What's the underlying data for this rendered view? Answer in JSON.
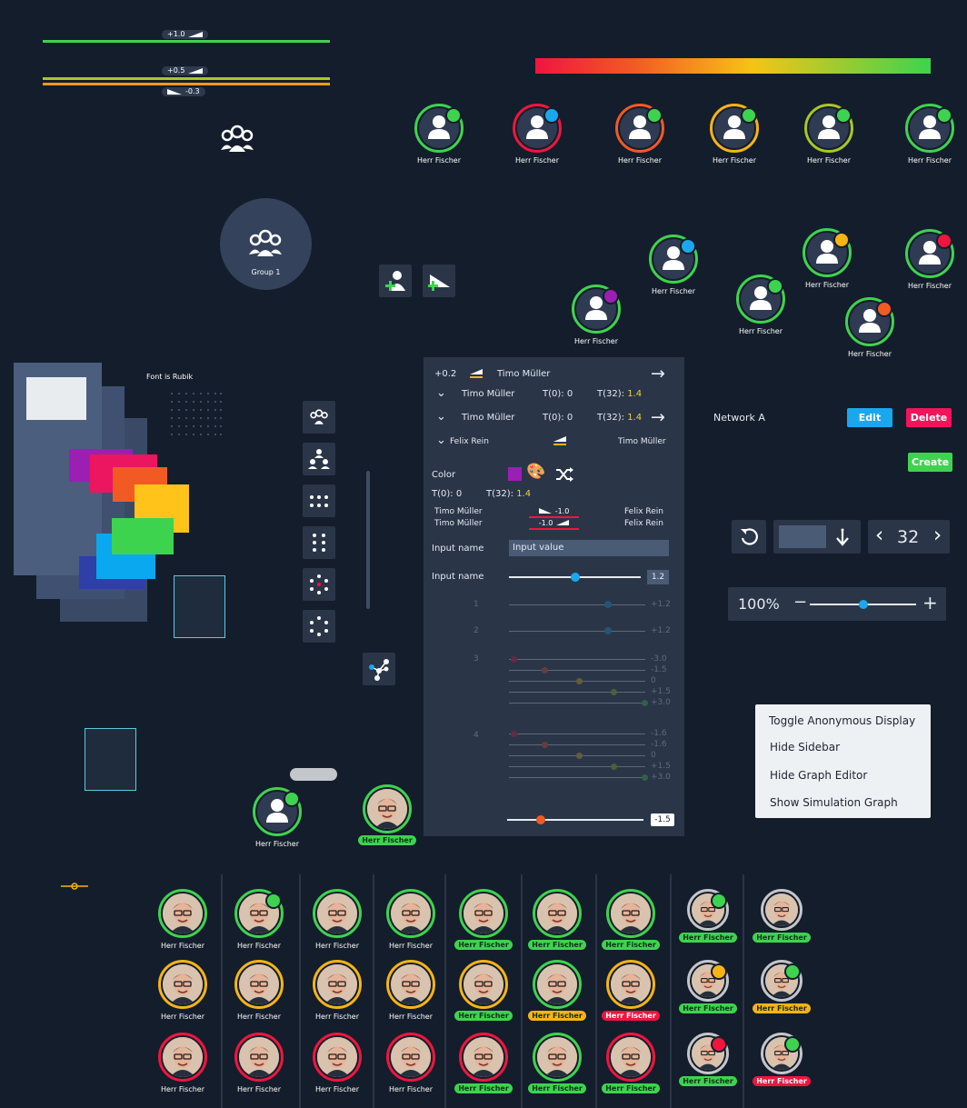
{
  "weights": {
    "top": "+1.0",
    "mid": "+0.5",
    "neg": "-0.3"
  },
  "header": {
    "font_note": "Font is Rubik"
  },
  "group": {
    "label": "Group 1"
  },
  "person": {
    "name": "Herr Fischer"
  },
  "top_avatars": [
    {
      "ring": "#3ed34f",
      "dot": "#3ed34f"
    },
    {
      "ring": "#f0153f",
      "dot": "#1aa7ee"
    },
    {
      "ring": "#f25a24",
      "dot": "#3ed34f"
    },
    {
      "ring": "#f6b415",
      "dot": "#3ed34f"
    },
    {
      "ring": "#a7c824",
      "dot": "#3ed34f"
    },
    {
      "ring": "#3ed34f",
      "dot": "#3ed34f"
    }
  ],
  "colors": {
    "green": "#3ed34f",
    "yellow": "#f6b415",
    "red": "#f0153f",
    "blue": "#1aa7ee",
    "accent_bg": "#2a3548"
  },
  "panel": {
    "r1": {
      "weight": "+0.2",
      "name": "Timo Müller"
    },
    "r2": {
      "name": "Timo Müller",
      "t0": "T(0):  0",
      "t32": "T(32): ",
      "t32v": "1.4"
    },
    "r3": {
      "name": "Timo Müller",
      "t0": "T(0):  0",
      "t32": "T(32): ",
      "t32v": "1.4"
    },
    "r4": {
      "name": "Felix Rein",
      "right": "Timo Müller"
    },
    "color_label": "Color",
    "t_row": {
      "t0": "T(0):  0",
      "t32": "T(32): ",
      "t32v": "1.4"
    },
    "links": [
      {
        "left": "Timo Müller",
        "val": "-1.0",
        "right": "Felix Rein"
      },
      {
        "left": "Timo Müller",
        "val": "-1.0",
        "right": "Felix Rein"
      }
    ],
    "input_name": "Input name",
    "input_value": "Input value",
    "input_name2": "Input name",
    "slider_value": "1.2",
    "faded_rows": [
      "1",
      "2",
      "3",
      "4"
    ],
    "faded_vals": {
      "r1": "+1.2",
      "r2": "+1.2",
      "r3": [
        "-3.0",
        "-1.5",
        "0",
        "+1.5",
        "+3.0"
      ],
      "r4": [
        "-1.6",
        "-1.6",
        "0",
        "+1.5",
        "+3.0"
      ]
    },
    "bottom_val": "-1.5"
  },
  "network": {
    "name": "Network A",
    "edit": "Edit",
    "delete": "Delete",
    "create": "Create"
  },
  "stepper": {
    "value": "32"
  },
  "zoom": {
    "value": "100%",
    "minus": "−",
    "plus": "+"
  },
  "menu": {
    "items": [
      "Toggle Anonymous Display",
      "Hide Sidebar",
      "Hide Graph Editor",
      "Show Simulation Graph"
    ]
  }
}
